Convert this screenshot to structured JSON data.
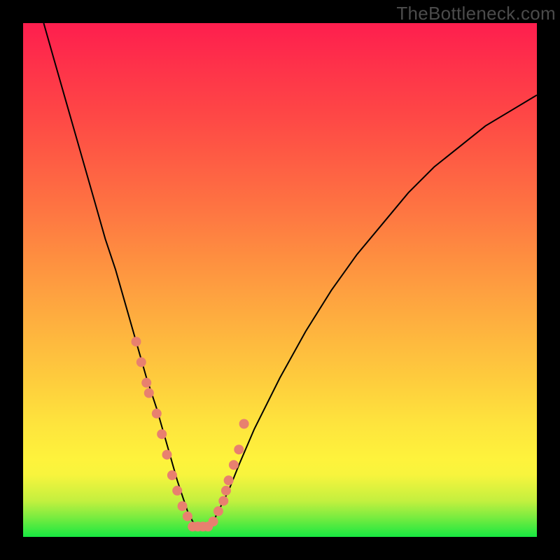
{
  "watermark": "TheBottleneck.com",
  "chart_data": {
    "type": "line",
    "title": "",
    "xlabel": "",
    "ylabel": "",
    "xlim": [
      0,
      100
    ],
    "ylim": [
      0,
      100
    ],
    "grid": false,
    "series": [
      {
        "name": "bottleneck-curve",
        "x": [
          4,
          6,
          8,
          10,
          12,
          14,
          16,
          18,
          20,
          22,
          24,
          26,
          28,
          30,
          31,
          32,
          33,
          34,
          35,
          36,
          37,
          38,
          40,
          42,
          45,
          50,
          55,
          60,
          65,
          70,
          75,
          80,
          85,
          90,
          95,
          100
        ],
        "y": [
          100,
          93,
          86,
          79,
          72,
          65,
          58,
          52,
          45,
          38,
          31,
          25,
          18,
          11,
          8,
          5,
          3,
          2,
          2,
          2,
          3,
          5,
          9,
          14,
          21,
          31,
          40,
          48,
          55,
          61,
          67,
          72,
          76,
          80,
          83,
          86
        ],
        "stroke": "#000000",
        "stroke_width": 2
      }
    ],
    "markers": [
      {
        "name": "highlight-dots",
        "x": [
          22,
          23,
          24,
          24.5,
          26,
          27,
          28,
          29,
          30,
          31,
          32,
          33,
          34,
          35,
          36,
          37,
          38,
          39,
          39.5,
          40,
          41,
          42,
          43
        ],
        "y": [
          38,
          34,
          30,
          28,
          24,
          20,
          16,
          12,
          9,
          6,
          4,
          2,
          2,
          2,
          2,
          3,
          5,
          7,
          9,
          11,
          14,
          17,
          22
        ],
        "marker_color": "#e8806f",
        "marker_radius_px": 7
      }
    ]
  }
}
